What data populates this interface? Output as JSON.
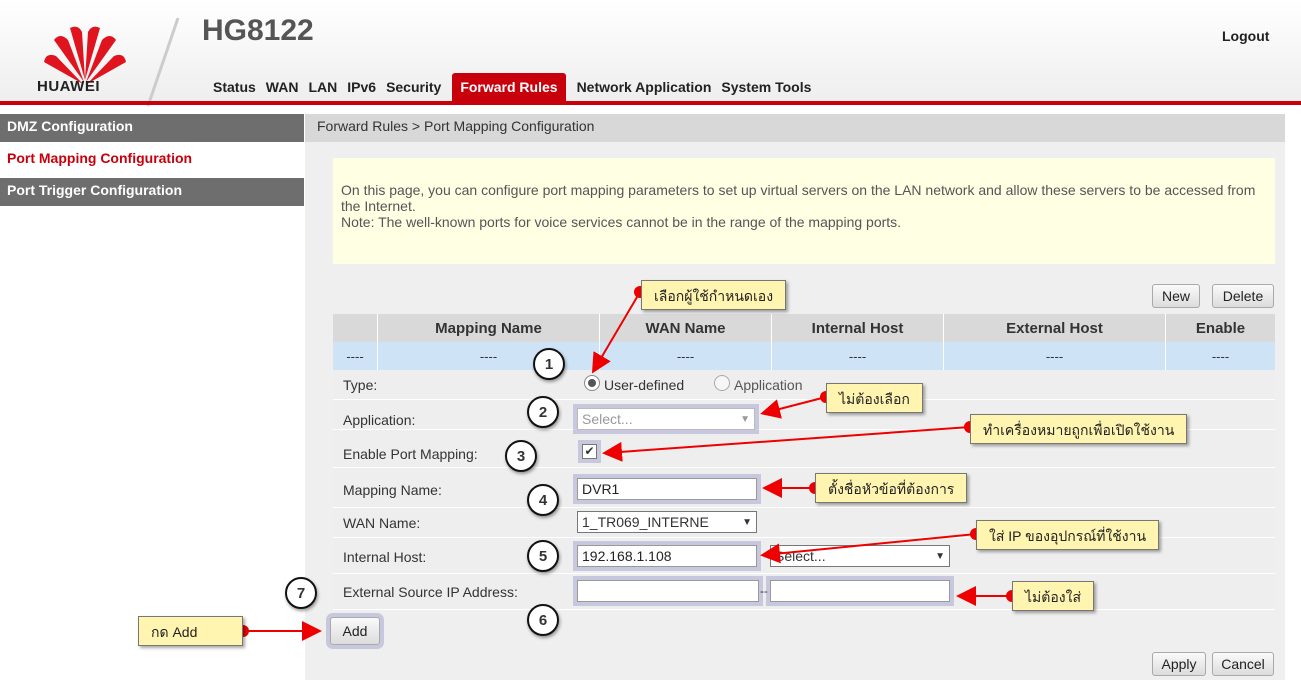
{
  "header": {
    "brand": "HUAWEI",
    "model": "HG8122",
    "logout": "Logout"
  },
  "nav": [
    "Status",
    "WAN",
    "LAN",
    "IPv6",
    "Security",
    "Forward Rules",
    "Network Application",
    "System Tools"
  ],
  "nav_active": "Forward Rules",
  "sidebar": {
    "items": [
      "DMZ Configuration",
      "Port Mapping Configuration",
      "Port Trigger Configuration"
    ]
  },
  "breadcrumb": "Forward Rules > Port Mapping Configuration",
  "note": {
    "line1": "On this page, you can configure port mapping parameters to set up virtual servers on the LAN network and allow these servers to be accessed from the Internet.",
    "line2": "Note: The well-known ports for voice services cannot be in the range of the mapping ports."
  },
  "buttons": {
    "new": "New",
    "delete": "Delete",
    "add": "Add",
    "apply": "Apply",
    "cancel": "Cancel"
  },
  "table": {
    "headers": [
      "",
      "Mapping Name",
      "WAN Name",
      "Internal Host",
      "External Host",
      "Enable"
    ],
    "row": [
      "----",
      "----",
      "----",
      "----",
      "----",
      "----"
    ]
  },
  "form": {
    "type_label": "Type:",
    "type_opt1": "User-defined",
    "type_opt2": "Application",
    "app_label": "Application:",
    "app_value": "Select...",
    "enable_label": "Enable Port Mapping:",
    "name_label": "Mapping Name:",
    "name_value": "DVR1",
    "wan_label": "WAN Name:",
    "wan_value": "1_TR069_INTERNE",
    "host_label": "Internal Host:",
    "host_value": "192.168.1.108",
    "host_select": "Select...",
    "ext_label": "External Source IP Address:",
    "ext_sep": "--"
  },
  "callouts": {
    "c1": "เลือกผู้ใช้กำหนดเอง",
    "c2": "ไม่ต้องเลือก",
    "c3": "ทำเครื่องหมายถูกเพื่อเปิดใช้งาน",
    "c4": "ตั้งชื่อหัวข้อที่ต้องการ",
    "c5": "ใส่ IP ของอุปกรณ์ที่ใช้งาน",
    "c6": "ไม่ต้องใส่",
    "c7": "กด Add"
  },
  "steps": [
    "1",
    "2",
    "3",
    "4",
    "5",
    "6",
    "7"
  ],
  "colors": {
    "brand_red": "#c7000b",
    "sidebar_gray": "#6e6e6e",
    "callout_yellow": "#fff4b0",
    "note_bg": "#ffffe4"
  }
}
